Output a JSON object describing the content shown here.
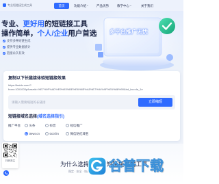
{
  "theme": {
    "primary": "#2f6bff",
    "text_dark": "#1b2444",
    "check_green": "#22c58b"
  },
  "header": {
    "logo_text": "专业短链接生成工具",
    "nav": [
      {
        "label": "首页",
        "active": true
      },
      {
        "label": "功能介绍",
        "has_dropdown": true
      },
      {
        "label": "产品优势"
      },
      {
        "label": "教学中心",
        "has_dropdown": true
      },
      {
        "label": "关于我们"
      }
    ]
  },
  "hero": {
    "title_line1": {
      "prefix": "专业、",
      "highlight": "更好用",
      "suffix": "的短链接工具"
    },
    "title_line2": {
      "prefix": "操作简单，",
      "highlight": "个人/企业",
      "suffix": "用户首选"
    },
    "features": [
      "支持多种短链生成",
      "提供专业数据统计",
      "链接永久有效"
    ],
    "illustration_text": "多平台推广无忧"
  },
  "converter": {
    "heading": "复制以下长链接体验短链接效果",
    "sample_url_line1": "https://baidu.com/?",
    "sample_url_line2": "from=1001003p/baseid=%E7%9F%AD%E9%93%BE%E6%8E%A5%E7%94%9F%E6%88%90&bd_kw=da_1e",
    "input_placeholder": "请输入需要缩短的长链接",
    "submit_label": "立即缩短"
  },
  "domain_select": {
    "title": "短链接域名选择",
    "guide_link": "(域名选择指引)",
    "platform_label": "推广平台",
    "platform_options": [
      {
        "label": "头条",
        "checked": false
      },
      {
        "label": "抖音",
        "checked": false
      },
      {
        "label": "短信推广",
        "checked": false
      }
    ],
    "domain_options": [
      {
        "label": "0ewr.cn",
        "checked": true
      },
      {
        "label": "0c0.fm",
        "checked": false
      },
      {
        "label": "微信防红域名",
        "checked": false
      }
    ]
  },
  "why": {
    "title": "为什么选择我们的短链接生成工具",
    "subtitle": "稳定 · 安全 · 快速的短链接服务"
  },
  "sidebar": {
    "qr_caption": "扫码关注",
    "contact_icon": "phone-icon"
  },
  "watermark": {
    "text": "谷普下载"
  }
}
